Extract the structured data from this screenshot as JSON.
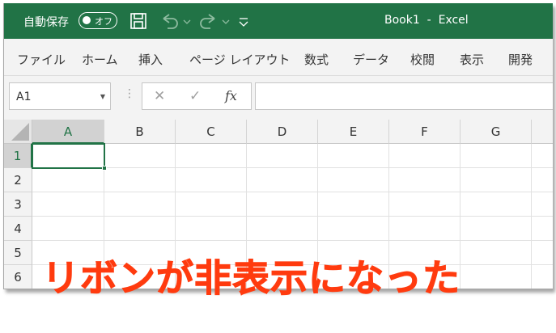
{
  "titlebar": {
    "autosave_label": "自動保存",
    "autosave_state": "オフ",
    "save_icon": "save-icon",
    "undo_icon": "undo-icon",
    "redo_icon": "redo-icon",
    "customize_icon": "customize-qat-icon",
    "title": "Book1  -  Excel",
    "color": "#217346"
  },
  "menu": {
    "tabs": [
      "ファイル",
      "ホーム",
      "挿入",
      "ページ レイアウト",
      "数式",
      "データ",
      "校閲",
      "表示",
      "開発"
    ]
  },
  "formula_bar": {
    "name_box": "A1",
    "cancel_symbol": "✕",
    "enter_symbol": "✓",
    "fx_label": "fx",
    "formula": ""
  },
  "sheet": {
    "columns": [
      "A",
      "B",
      "C",
      "D",
      "E",
      "F",
      "G"
    ],
    "rows": [
      "1",
      "2",
      "3",
      "4",
      "5",
      "6"
    ],
    "active_cell": "A1"
  },
  "caption": "リボンが非表示になった"
}
